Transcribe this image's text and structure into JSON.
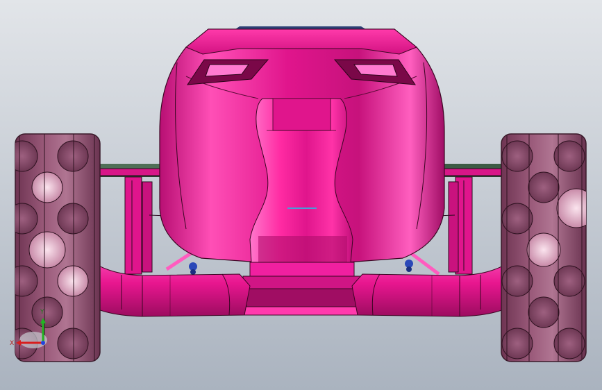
{
  "viewport": {
    "background_top": "#e2e5e9",
    "background_bottom": "#aab3bf"
  },
  "model": {
    "body_color": "#e0158c",
    "body_highlight": "#ff66c4",
    "body_shadow": "#8a0a52",
    "wheel_color": "#8c4a6c",
    "wheel_highlight": "#e8b8cc",
    "suspension_color": "#1f3ea8",
    "frame_color": "#3c5a44"
  },
  "triad": {
    "x_label": "X",
    "y_label": "Y",
    "x_color": "#d81e1e",
    "y_color": "#22b422",
    "z_color": "#2244dd"
  }
}
